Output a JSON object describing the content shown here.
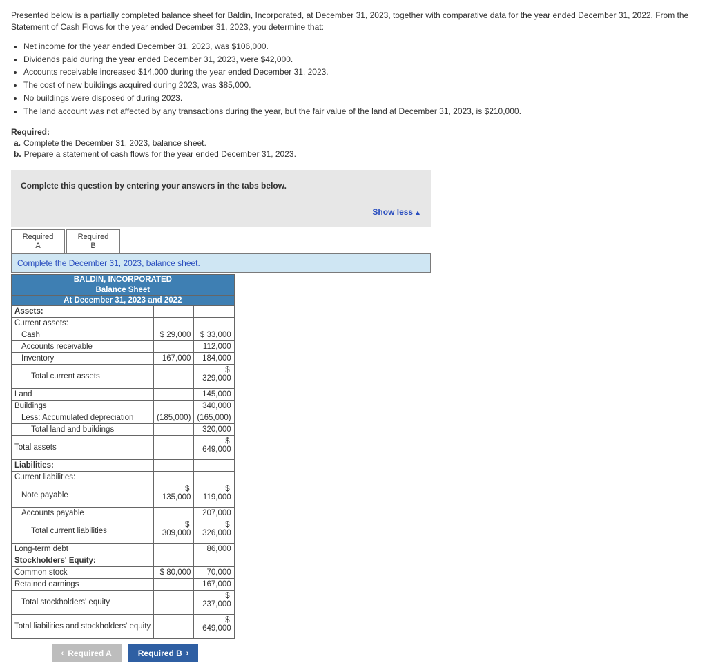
{
  "intro": "Presented below is a partially completed balance sheet for Baldin, Incorporated, at December 31, 2023, together with comparative data for the year ended December 31, 2022. From the Statement of Cash Flows for the year ended December 31, 2023, you determine that:",
  "facts": [
    "Net income for the year ended December 31, 2023, was $106,000.",
    "Dividends paid during the year ended December 31, 2023, were $42,000.",
    "Accounts receivable increased $14,000 during the year ended December 31, 2023.",
    "The cost of new buildings acquired during 2023, was $85,000.",
    "No buildings were disposed of during 2023.",
    "The land account was not affected by any transactions during the year, but the fair value of the land at December 31, 2023, is $210,000."
  ],
  "required_label": "Required:",
  "required_items": [
    {
      "key": "a.",
      "text": "Complete the December 31, 2023, balance sheet."
    },
    {
      "key": "b.",
      "text": "Prepare a statement of cash flows for the year ended December 31, 2023."
    }
  ],
  "graybox_prompt": "Complete this question by entering your answers in the tabs below.",
  "show_less": "Show less",
  "tabs": {
    "a": {
      "line1": "Required",
      "line2": "A"
    },
    "b": {
      "line1": "Required",
      "line2": "B"
    }
  },
  "instruction": "Complete the December 31, 2023, balance sheet.",
  "sheet": {
    "title1": "BALDIN, INCORPORATED",
    "title2": "Balance Sheet",
    "title3": "At December 31, 2023 and 2022",
    "rows": {
      "assets": "Assets:",
      "current_assets": "Current assets:",
      "cash": {
        "label": "Cash",
        "c1": "$ 29,000",
        "c2": "$ 33,000"
      },
      "ar": {
        "label": "Accounts receivable",
        "c1": "",
        "c2": "112,000"
      },
      "inv": {
        "label": "Inventory",
        "c1": "167,000",
        "c2": "184,000"
      },
      "tca": {
        "label": "Total current assets",
        "c1": "",
        "c2_top": "$",
        "c2": "329,000"
      },
      "land": {
        "label": "Land",
        "c1": "",
        "c2": "145,000"
      },
      "bldg": {
        "label": "Buildings",
        "c1": "",
        "c2": "340,000"
      },
      "dep": {
        "label": "Less: Accumulated depreciation",
        "c1": "(185,000)",
        "c2": "(165,000)"
      },
      "tlb": {
        "label": "Total land and buildings",
        "c1": "",
        "c2": "320,000"
      },
      "ta": {
        "label": "Total assets",
        "c1": "",
        "c2_top": "$",
        "c2": "649,000"
      },
      "liab": "Liabilities:",
      "cliab": "Current liabilities:",
      "np": {
        "label": "Note payable",
        "c1_top": "$",
        "c1": "135,000",
        "c2_top": "$",
        "c2": "119,000"
      },
      "ap": {
        "label": "Accounts payable",
        "c1": "",
        "c2": "207,000"
      },
      "tcl": {
        "label": "Total current liabilities",
        "c1_top": "$",
        "c1": "309,000",
        "c2_top": "$",
        "c2": "326,000"
      },
      "ltd": {
        "label": "Long-term debt",
        "c1": "",
        "c2": "86,000"
      },
      "se": "Stockholders' Equity:",
      "cs": {
        "label": "Common stock",
        "c1": "$ 80,000",
        "c2": "70,000"
      },
      "re": {
        "label": "Retained earnings",
        "c1": "",
        "c2": "167,000"
      },
      "tse": {
        "label": "Total stockholders' equity",
        "c1": "",
        "c2_top": "$",
        "c2": "237,000"
      },
      "tlse": {
        "label": "Total liabilities and stockholders' equity",
        "c1": "",
        "c2_top": "$",
        "c2": "649,000"
      }
    }
  },
  "nav": {
    "prev": "Required A",
    "next": "Required B"
  }
}
